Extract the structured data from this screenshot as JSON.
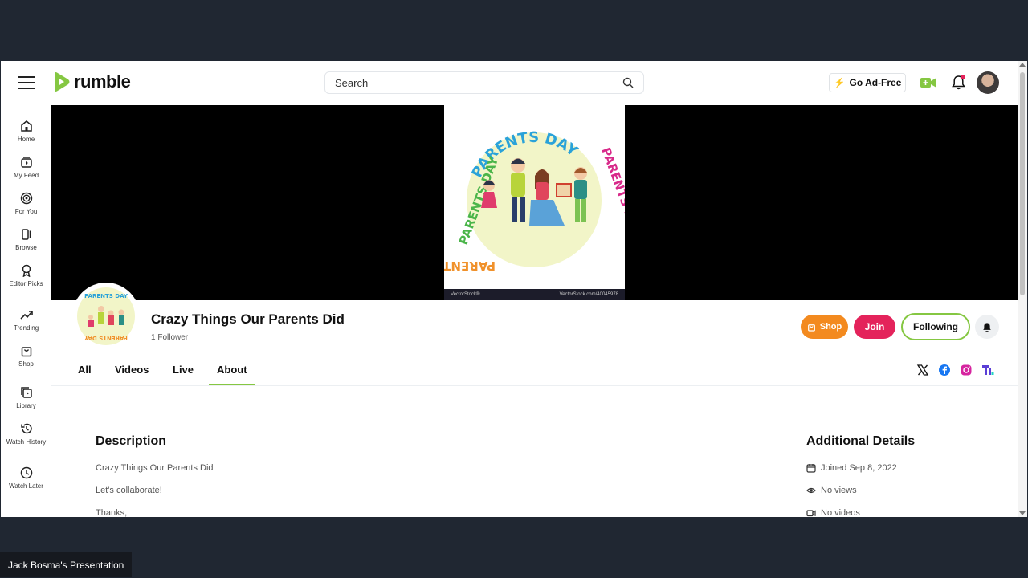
{
  "header": {
    "logo_text": "rumble",
    "search_placeholder": "Search",
    "ad_free_label": "Go Ad-Free",
    "brand_color": "#85c742"
  },
  "sidebar": {
    "items": [
      {
        "label": "Home",
        "icon": "home-icon"
      },
      {
        "label": "My Feed",
        "icon": "feed-icon"
      },
      {
        "label": "For You",
        "icon": "target-icon"
      },
      {
        "label": "Browse",
        "icon": "browse-icon"
      },
      {
        "label": "Editor Picks",
        "icon": "award-icon"
      },
      {
        "label": "Trending",
        "icon": "trending-icon"
      },
      {
        "label": "Shop",
        "icon": "shopping-bag-icon"
      },
      {
        "label": "Library",
        "icon": "library-icon"
      },
      {
        "label": "Watch History",
        "icon": "history-icon"
      },
      {
        "label": "Watch Later",
        "icon": "clock-icon"
      }
    ]
  },
  "banner": {
    "art_title": "PARENTS DAY",
    "watermark_left": "VectorStock®",
    "watermark_right": "VectorStock.com/40045978"
  },
  "channel": {
    "name": "Crazy Things Our Parents Did",
    "followers": "1 Follower",
    "shop_label": "Shop",
    "join_label": "Join",
    "following_label": "Following"
  },
  "tabs": [
    {
      "label": "All",
      "active": false
    },
    {
      "label": "Videos",
      "active": false
    },
    {
      "label": "Live",
      "active": false
    },
    {
      "label": "About",
      "active": true
    }
  ],
  "social_icons": [
    "x-icon",
    "facebook-icon",
    "instagram-icon",
    "truth-social-icon"
  ],
  "about": {
    "description_heading": "Description",
    "description_lines": [
      "Crazy Things Our Parents Did",
      "Let's collaborate!",
      "Thanks,"
    ],
    "details_heading": "Additional Details",
    "details": [
      {
        "icon": "calendar-icon",
        "text": "Joined Sep 8, 2022"
      },
      {
        "icon": "eye-icon",
        "text": "No views"
      },
      {
        "icon": "video-icon",
        "text": "No videos"
      }
    ]
  },
  "presenter_label": "Jack Bosma's Presentation"
}
